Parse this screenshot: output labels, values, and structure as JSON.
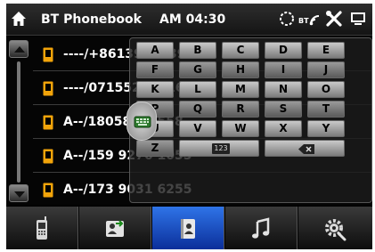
{
  "header": {
    "title": "BT Phonebook",
    "time": "AM 04:30",
    "bluetooth_label": "BT"
  },
  "icons": {
    "home": "home-icon",
    "loading": "loading-ring-icon",
    "bluetooth_signal": "bluetooth-signal-icon",
    "settings": "tools-icon",
    "device": "device-icon",
    "contact": "phone-contact-icon",
    "keyboard_toggle": "keyboard-icon"
  },
  "contacts": [
    {
      "text": "----/+8613922839821"
    },
    {
      "text": "----/07155222616"
    },
    {
      "text": "A--/18058825558"
    },
    {
      "text": "A--/159 9276 1055"
    },
    {
      "text": "A--/173 9031 6255"
    }
  ],
  "keyboard": {
    "rows": [
      [
        "A",
        "B",
        "C",
        "D",
        "E"
      ],
      [
        "F",
        "G",
        "H",
        "I",
        "J"
      ],
      [
        "K",
        "L",
        "M",
        "N",
        "O"
      ],
      [
        "P",
        "Q",
        "R",
        "S",
        "T"
      ],
      [
        "U",
        "V",
        "W",
        "X",
        "Y"
      ]
    ],
    "last_key": "Z",
    "numeric_label": "123"
  },
  "bottom_nav": [
    {
      "name": "phone-tab",
      "icon": "phone-icon"
    },
    {
      "name": "contacts-transfer-tab",
      "icon": "contacts-transfer-icon"
    },
    {
      "name": "phonebook-tab",
      "icon": "phonebook-icon",
      "active": true
    },
    {
      "name": "music-tab",
      "icon": "music-icon"
    },
    {
      "name": "settings-tab",
      "icon": "settings-gear-icon"
    }
  ],
  "colors": {
    "accent_blue": "#1e56d8",
    "contact_icon": "#f2a40a",
    "background": "#000000"
  }
}
